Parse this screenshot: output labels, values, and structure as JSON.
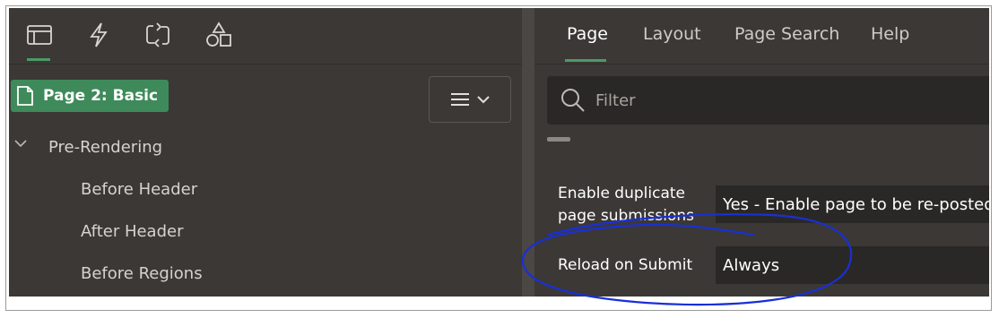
{
  "left_toolbar": {
    "icons": [
      "rendering-tree-icon",
      "dynamic-actions-icon",
      "processing-icon",
      "shared-components-icon"
    ]
  },
  "tree": {
    "root": "Page 2: Basic",
    "section": "Pre-Rendering",
    "children": [
      "Before Header",
      "After Header",
      "Before Regions"
    ]
  },
  "right_tabs": [
    "Page",
    "Layout",
    "Page Search",
    "Help"
  ],
  "filter": {
    "placeholder": "Filter"
  },
  "properties": [
    {
      "label": "Enable duplicate page submissions",
      "value": "Yes - Enable page to be re-posted"
    },
    {
      "label": "Reload on Submit",
      "value": "Always"
    }
  ],
  "colors": {
    "accent": "#3f8a5a",
    "background": "#3b3835",
    "annotation": "#1a2fd6"
  }
}
